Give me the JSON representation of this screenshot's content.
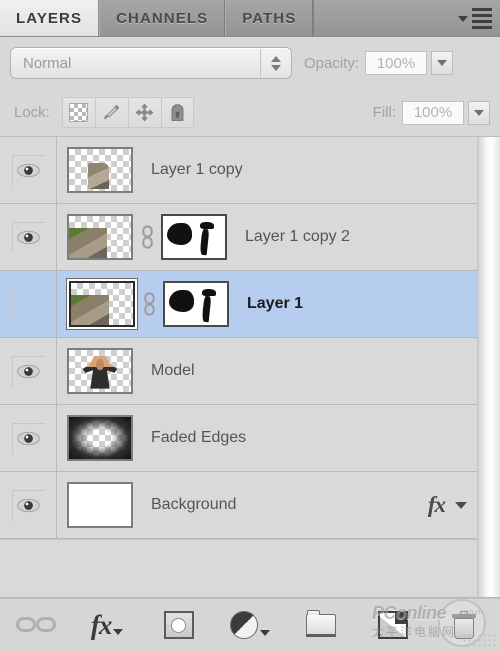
{
  "panel": {
    "tabs": [
      {
        "label": "LAYERS",
        "active": true
      },
      {
        "label": "CHANNELS",
        "active": false
      },
      {
        "label": "PATHS",
        "active": false
      }
    ],
    "menu_icon": "panel-menu-icon"
  },
  "blend": {
    "mode_value": "Normal",
    "opacity_label": "Opacity:",
    "opacity_value": "100%",
    "spinner_icon": "up-down-spinner-icon",
    "opacity_dropdown_icon": "chevron-down-icon"
  },
  "lock": {
    "label": "Lock:",
    "buttons": [
      {
        "name": "lock-transparent-pixels",
        "icon": "checkerboard-icon"
      },
      {
        "name": "lock-image-pixels",
        "icon": "brush-icon"
      },
      {
        "name": "lock-position",
        "icon": "move-arrows-icon"
      },
      {
        "name": "lock-all",
        "icon": "padlock-icon"
      }
    ],
    "fill_label": "Fill:",
    "fill_value": "100%",
    "fill_dropdown_icon": "chevron-down-icon"
  },
  "layers": [
    {
      "name": "Layer 1 copy",
      "visible": true,
      "selected": false,
      "has_mask": false,
      "linked": false,
      "has_fx": false,
      "thumb_kind": "transparent-photo-small"
    },
    {
      "name": "Layer 1 copy 2",
      "visible": true,
      "selected": false,
      "has_mask": true,
      "linked": true,
      "has_fx": false,
      "thumb_kind": "transparent-photo"
    },
    {
      "name": "Layer 1",
      "visible": false,
      "selected": true,
      "has_mask": true,
      "linked": true,
      "has_fx": false,
      "thumb_kind": "transparent-photo"
    },
    {
      "name": "Model",
      "visible": true,
      "selected": false,
      "has_mask": false,
      "linked": false,
      "has_fx": false,
      "thumb_kind": "model"
    },
    {
      "name": "Faded Edges",
      "visible": true,
      "selected": false,
      "has_mask": false,
      "linked": false,
      "has_fx": false,
      "thumb_kind": "faded"
    },
    {
      "name": "Background",
      "visible": true,
      "selected": false,
      "has_mask": false,
      "linked": false,
      "has_fx": true,
      "fx_label": "fx",
      "thumb_kind": "white"
    }
  ],
  "bottom_bar": [
    {
      "name": "link-layers-button",
      "icon": "chain-link-icon"
    },
    {
      "name": "add-layer-style-button",
      "icon": "fx-icon",
      "label": "fx"
    },
    {
      "name": "add-layer-mask-button",
      "icon": "layer-mask-icon"
    },
    {
      "name": "new-adjustment-layer-button",
      "icon": "half-filled-circle-icon"
    },
    {
      "name": "new-group-button",
      "icon": "folder-icon"
    },
    {
      "name": "new-layer-button",
      "icon": "new-layer-icon"
    },
    {
      "name": "delete-layer-button",
      "icon": "trash-icon"
    }
  ],
  "watermark": {
    "brand": "PConline",
    "domain": ".com.cn",
    "subtitle": "太平洋电脑网"
  }
}
